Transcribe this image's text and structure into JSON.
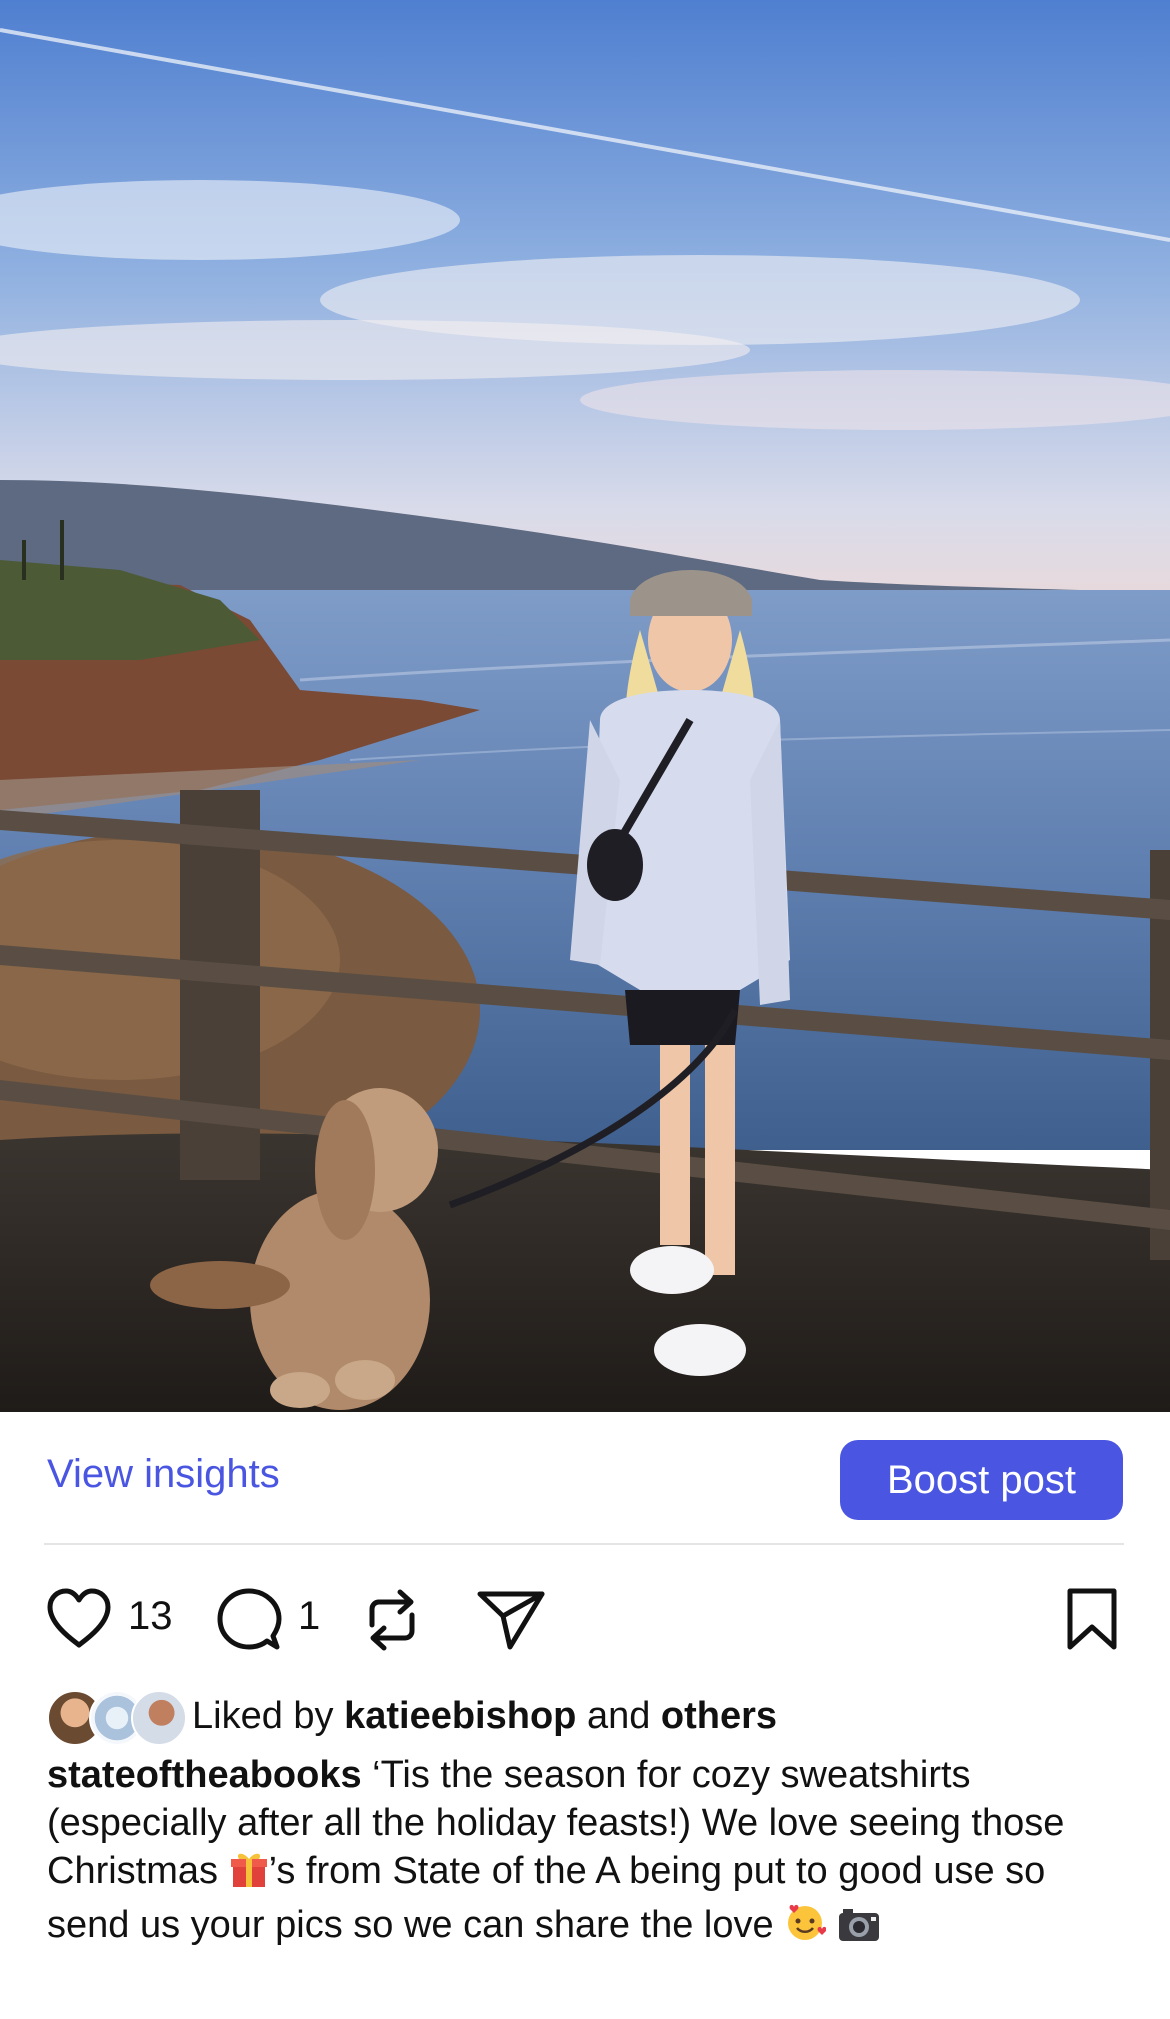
{
  "post": {
    "photo": {
      "description_icon": "photo-icon"
    },
    "view_insights": "View insights",
    "boost_post": "Boost post",
    "likes_count": "13",
    "comments_count": "1",
    "liked_by_prefix": "Liked by ",
    "liked_by_user": "katieebishop",
    "liked_by_and": " and ",
    "liked_by_others": "others",
    "caption_user": "stateoftheabooks",
    "caption_part1": " ‘Tis the season for cozy sweatshirts (especially after all the holiday feasts!) We love seeing those Christmas ",
    "caption_part2": "’s from State of the A being put to good use so send us your pics so we can share the love ",
    "icons": {
      "like": "heart-icon",
      "comment": "comment-icon",
      "repost": "repost-icon",
      "share": "send-icon",
      "save": "bookmark-icon",
      "gift": "gift-emoji",
      "smile": "smiling-face-hearts-emoji",
      "camera": "camera-emoji"
    }
  },
  "colors": {
    "accent": "#4a56e2",
    "text": "#111111",
    "divider": "#e5e5e5"
  }
}
